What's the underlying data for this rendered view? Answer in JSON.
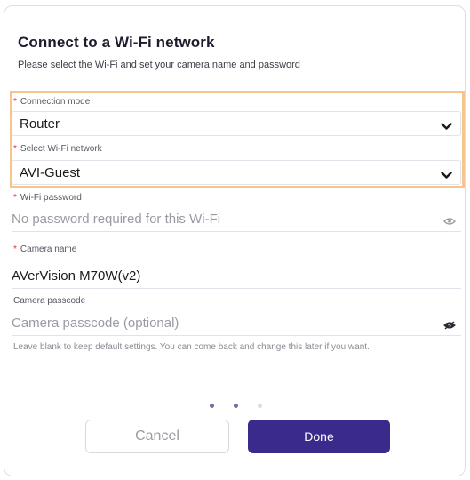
{
  "dialog": {
    "title": "Connect to a Wi-Fi network",
    "subtitle": "Please select the Wi-Fi and set your camera name and password"
  },
  "connection_mode": {
    "label": "Connection mode",
    "required_mark": "*",
    "value": "Router"
  },
  "wifi_network": {
    "label": "Select Wi-Fi network",
    "required_mark": "*",
    "value": "AVI-Guest"
  },
  "wifi_password": {
    "label": "Wi-Fi password",
    "required_mark": "*",
    "placeholder": "No password required for this Wi-Fi",
    "icon": "eye-icon"
  },
  "camera_name": {
    "label": "Camera name",
    "required_mark": "*",
    "value": "AVerVision M70W(v2)"
  },
  "camera_passcode": {
    "label": "Camera passcode",
    "placeholder": "Camera passcode (optional)",
    "icon": "eye-off-icon",
    "helper": "Leave blank to keep default settings. You can come back and change this later if you want."
  },
  "pagination": {
    "current_step": 2,
    "total_steps": 3
  },
  "buttons": {
    "cancel_label": "Cancel",
    "done_label": "Done"
  },
  "colors": {
    "highlight": "#f6c48d",
    "primary": "#3a2a8c",
    "required": "#e3342f"
  }
}
